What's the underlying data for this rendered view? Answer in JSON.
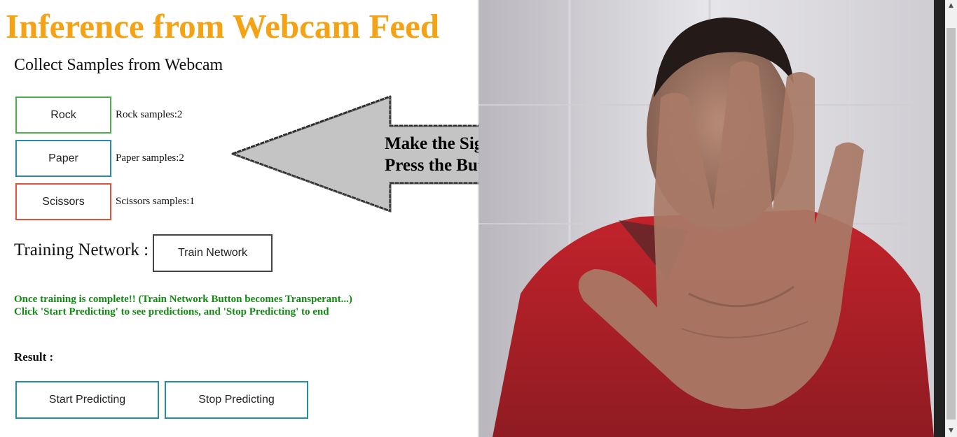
{
  "page": {
    "title": "Inference from Webcam Feed",
    "subtitle": "Collect Samples from Webcam"
  },
  "samples": {
    "rock_label": "Rock",
    "paper_label": "Paper",
    "scissors_label": "Scissors",
    "rock_count": "Rock samples:2",
    "paper_count": "Paper samples:2",
    "scissors_count": "Scissors samples:1"
  },
  "training": {
    "label": "Training Network :",
    "button_label": "Train Network",
    "note_line1": "Once training is complete!! (Train Network Button becomes Transperant...)",
    "note_line2": "Click 'Start Predicting' to see predictions, and 'Stop Predicting' to end"
  },
  "result": {
    "label": "Result :"
  },
  "prediction": {
    "start_label": "Start Predicting",
    "stop_label": "Stop Predicting"
  },
  "callout": {
    "line1": "Make the Sign and",
    "line2": "Press the Button.."
  },
  "colors": {
    "title": "#f5a316",
    "rock_border": "#4cae4c",
    "paper_border": "#2a88b5",
    "scissors_border": "#e0533a",
    "note": "#138a13",
    "predict_border": "#1f8fa8"
  },
  "icons": {
    "arrow": "left-arrow-icon",
    "scroll_up": "scroll-up-icon",
    "scroll_down": "scroll-down-icon"
  }
}
